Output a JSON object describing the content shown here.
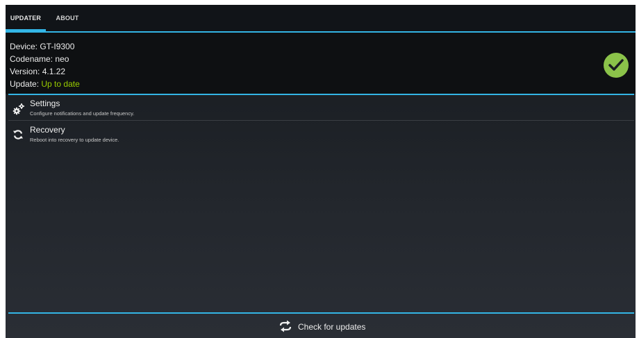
{
  "tabs": [
    {
      "label": "UPDATER",
      "selected": true
    },
    {
      "label": "ABOUT",
      "selected": false
    }
  ],
  "device_info": {
    "device_label": "Device:",
    "device_value": "GT-I9300",
    "codename_label": "Codename:",
    "codename_value": "neo",
    "version_label": "Version:",
    "version_value": "4.1.22",
    "update_label": "Update:",
    "update_value": "Up to date",
    "status_icon": "checkmark-circle-icon",
    "status_color": "#8bc34a",
    "update_value_color": "#99cc00"
  },
  "list": [
    {
      "icon": "gears-icon",
      "title": "Settings",
      "subtitle": "Configure notifications and update frequency."
    },
    {
      "icon": "refresh-icon",
      "title": "Recovery",
      "subtitle": "Reboot into recovery to update device."
    }
  ],
  "footer": {
    "icon": "sync-arrows-icon",
    "label": "Check for updates"
  },
  "colors": {
    "accent": "#33b5e5",
    "background_dark": "#0e1012"
  }
}
